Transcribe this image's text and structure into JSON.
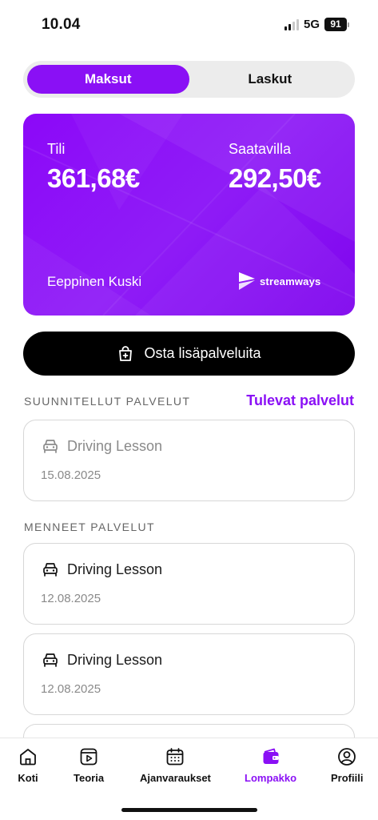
{
  "status_bar": {
    "time": "10.04",
    "network": "5G",
    "battery": "91"
  },
  "segments": [
    {
      "label": "Maksut",
      "active": true
    },
    {
      "label": "Laskut",
      "active": false
    }
  ],
  "wallet": {
    "account_label": "Tili",
    "account_value": "361,68€",
    "available_label": "Saatavilla",
    "available_value": "292,50€",
    "holder": "Eeppinen Kuski",
    "brand": "streamways"
  },
  "buy_button": {
    "label": "Osta lisäpalveluita",
    "icon": "shopping-bag-plus-icon"
  },
  "planned": {
    "title": "SUUNNITELLUT PALVELUT",
    "link": "Tulevat palvelut",
    "items": [
      {
        "title": "Driving Lesson",
        "date": "15.08.2025",
        "icon": "car-icon"
      }
    ]
  },
  "past": {
    "title": "MENNEET PALVELUT",
    "items": [
      {
        "title": "Driving Lesson",
        "date": "12.08.2025",
        "icon": "car-icon"
      },
      {
        "title": "Driving Lesson",
        "date": "12.08.2025",
        "icon": "car-icon"
      }
    ]
  },
  "tabs": [
    {
      "label": "Koti",
      "icon": "home-icon"
    },
    {
      "label": "Teoria",
      "icon": "play-book-icon"
    },
    {
      "label": "Ajanvaraukset",
      "icon": "calendar-icon"
    },
    {
      "label": "Lompakko",
      "icon": "wallet-icon",
      "active": true
    },
    {
      "label": "Profiili",
      "icon": "profile-icon"
    }
  ],
  "colors": {
    "accent": "#8a10f5",
    "dark": "#000000",
    "border": "#d7d7d7"
  }
}
